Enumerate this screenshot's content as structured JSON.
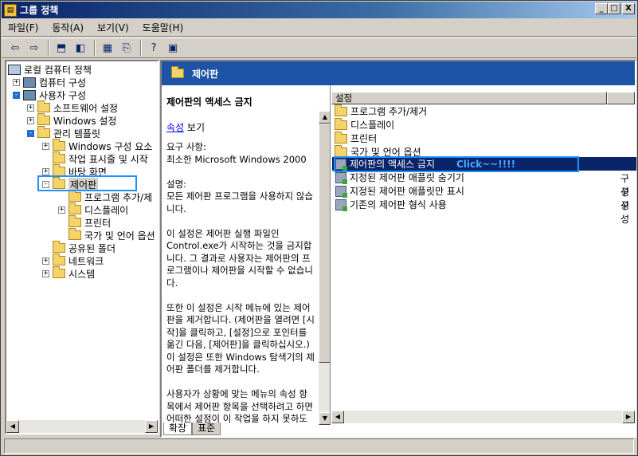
{
  "window": {
    "title": "그룹 정책",
    "buttons": [
      "_",
      "□",
      "X"
    ]
  },
  "menu": [
    "파일(F)",
    "동작(A)",
    "보기(V)",
    "도움말(H)"
  ],
  "toolbar": {
    "buttons": [
      "back-icon",
      "forward-icon",
      "up-folder-icon",
      "show-hide-tree-icon",
      "properties-icon",
      "export-list-icon",
      "help-icon",
      "view-icon"
    ]
  },
  "tree": {
    "items": [
      {
        "label": "로컬 컴퓨터 정책",
        "level": 0,
        "expander": "",
        "icon": "policy"
      },
      {
        "label": "컴퓨터 구성",
        "level": 1,
        "expander": "+",
        "icon": "pc"
      },
      {
        "label": "사용자 구성",
        "level": 1,
        "expander": "-",
        "icon": "pc"
      },
      {
        "label": "소프트웨어 설정",
        "level": 2,
        "expander": "+",
        "icon": "folder"
      },
      {
        "label": "Windows 설정",
        "level": 2,
        "expander": "+",
        "icon": "folder"
      },
      {
        "label": "관리 템플릿",
        "level": 2,
        "expander": "-",
        "icon": "folder"
      },
      {
        "label": "Windows 구성 요소",
        "level": 3,
        "expander": "+",
        "icon": "folder"
      },
      {
        "label": "작업 표시줄 및 시작",
        "level": 3,
        "expander": "",
        "icon": "folder"
      },
      {
        "label": "바탕 화면",
        "level": 3,
        "expander": "+",
        "icon": "folder"
      },
      {
        "label": "제어판",
        "level": 3,
        "expander": "-",
        "icon": "folder"
      },
      {
        "label": "프로그램 추가/제",
        "level": 4,
        "expander": "",
        "icon": "folder"
      },
      {
        "label": "디스플레이",
        "level": 4,
        "expander": "+",
        "icon": "folder"
      },
      {
        "label": "프린터",
        "level": 4,
        "expander": "",
        "icon": "folder"
      },
      {
        "label": "국가 및 언어 옵션",
        "level": 4,
        "expander": "",
        "icon": "folder"
      },
      {
        "label": "공유된 폴더",
        "level": 3,
        "expander": "",
        "icon": "folder"
      },
      {
        "label": "네트워크",
        "level": 3,
        "expander": "+",
        "icon": "folder"
      },
      {
        "label": "시스템",
        "level": 3,
        "expander": "+",
        "icon": "folder"
      }
    ]
  },
  "header": {
    "title": "제어판"
  },
  "description": {
    "title": "제어판의 액세스 금지",
    "link": "속성",
    "link_suffix": " 보기",
    "body": "요구 사항:\n최소한 Microsoft Windows 2000\n\n설명:\n모든 제어판 프로그램을 사용하지 않습니다.\n\n이 설정은 제어판 실행 파일인 Control.exe가 시작하는 것을 금지합니다. 그 결과로 사용자는 제어판의 프로그램이나 제어판을 시작할 수 없습니다.\n\n또한 이 설정은 시작 메뉴에 있는 제어판을 제거합니다. (제어판을 열려면 [시작]을 클릭하고, [설정]으로 포인터를 옮긴 다음, [제어판]을 클릭하십시오.) 이 설정은 또한 Windows 탐색기의 제어판 폴더를 제거합니다.\n\n사용자가 상황에 맞는 메뉴의 속성 항목에서 제어판 항목을 선택하려고 하면 어떠한 설정이 이 작업을 하지 못하도록 한다는 메시지가 표시됩니다."
  },
  "list": {
    "columns": [
      "설정",
      ""
    ],
    "rows": [
      {
        "label": "프로그램 추가/제거",
        "icon": "folder",
        "state": ""
      },
      {
        "label": "디스플레이",
        "icon": "folder",
        "state": ""
      },
      {
        "label": "프린터",
        "icon": "folder",
        "state": ""
      },
      {
        "label": "국가 및 언어 옵션",
        "icon": "folder",
        "state": ""
      },
      {
        "label": "제어판의 액세스 금지",
        "icon": "setting",
        "state": ""
      },
      {
        "label": "지정된 제어판 애플릿 숨기기",
        "icon": "setting",
        "state": "구성"
      },
      {
        "label": "지정된 제어판 애플릿만 표시",
        "icon": "setting",
        "state": "구성"
      },
      {
        "label": "기존의 제어판 형식 사용",
        "icon": "setting",
        "state": "구성"
      }
    ],
    "annotation": "Click~~!!!!"
  },
  "tabs": [
    "확장",
    "표준"
  ],
  "colors": {
    "title_gradient_start": "#0a246a",
    "header_band": "#1f53a5",
    "selection": "#0a246a",
    "annotation_box": "#1e90ff"
  }
}
